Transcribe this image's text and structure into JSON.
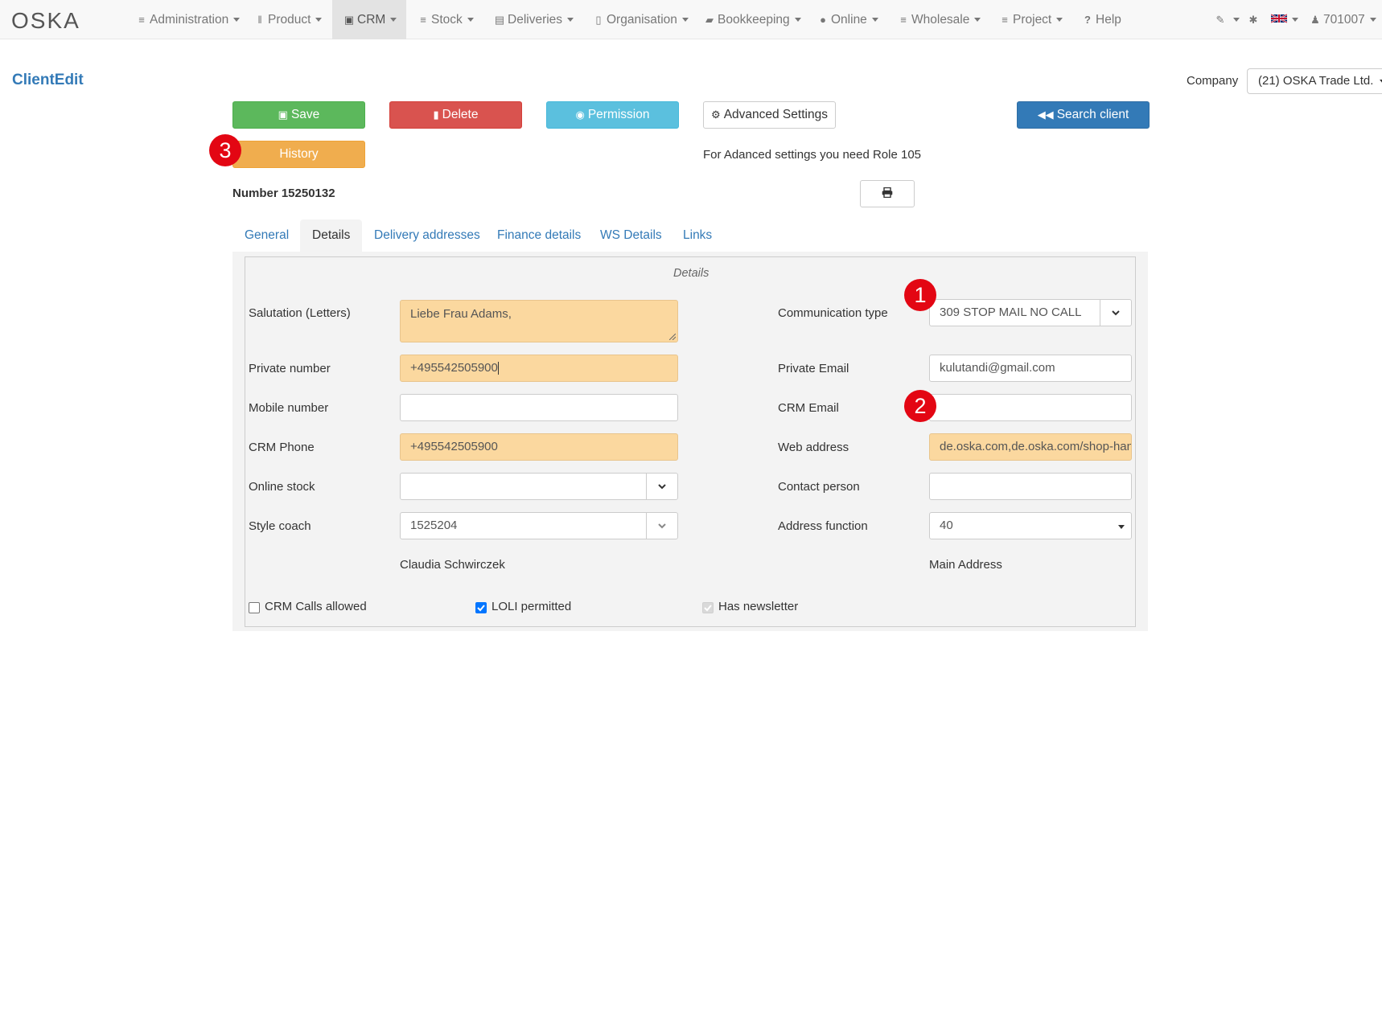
{
  "navbar": {
    "logo_text": "OSKA",
    "items": [
      {
        "label": "Administration",
        "icon": "list-icon"
      },
      {
        "label": "Product",
        "icon": "barcode-icon"
      },
      {
        "label": "CRM",
        "icon": "contact-card-icon"
      },
      {
        "label": "Stock",
        "icon": "list-icon"
      },
      {
        "label": "Deliveries",
        "icon": "archive-box-icon"
      },
      {
        "label": "Organisation",
        "icon": "building-icon"
      },
      {
        "label": "Bookkeeping",
        "icon": "book-icon"
      },
      {
        "label": "Online",
        "icon": "globe-icon"
      },
      {
        "label": "Wholesale",
        "icon": "list-icon"
      },
      {
        "label": "Project",
        "icon": "list-icon"
      },
      {
        "label": "Help",
        "icon": "question-icon"
      }
    ],
    "active_item": "CRM",
    "user_id": "701007",
    "language": "en-GB"
  },
  "page": {
    "title": "ClientEdit",
    "company_label": "Company",
    "company_value": "(21) OSKA Trade Ltd."
  },
  "buttons": {
    "save": "Save",
    "delete": "Delete",
    "permission": "Permission",
    "advanced_settings": "Advanced Settings",
    "search_client": "Search client",
    "history": "History"
  },
  "advanced_note": "For Adanced settings you need Role 105",
  "number_label": "Number 15250132",
  "tabs": [
    {
      "label": "General",
      "active": false
    },
    {
      "label": "Details",
      "active": true
    },
    {
      "label": "Delivery addresses",
      "active": false
    },
    {
      "label": "Finance details",
      "active": false
    },
    {
      "label": "WS Details",
      "active": false
    },
    {
      "label": "Links",
      "active": false
    }
  ],
  "details": {
    "legend": "Details",
    "salutation": {
      "label": "Salutation (Letters)",
      "value": "Liebe Frau Adams,"
    },
    "private_number": {
      "label": "Private number",
      "value": "+495542505900"
    },
    "mobile_number": {
      "label": "Mobile number",
      "value": ""
    },
    "crm_phone": {
      "label": "CRM Phone",
      "value": "+495542505900"
    },
    "online_stock": {
      "label": "Online stock",
      "value": ""
    },
    "style_coach": {
      "label": "Style coach",
      "value": "1525204",
      "name": "Claudia Schwirczek"
    },
    "communication_type": {
      "label": "Communication type",
      "value": "309 STOP MAIL NO CALL"
    },
    "private_email": {
      "label": "Private Email",
      "value": "kulutandi@gmail.com"
    },
    "crm_email": {
      "label": "CRM Email",
      "value": ""
    },
    "web_address": {
      "label": "Web address",
      "value": "de.oska.com,de.oska.com/shop-han"
    },
    "contact_person": {
      "label": "Contact person",
      "value": ""
    },
    "address_function": {
      "label": "Address function",
      "value": "40",
      "description": "Main Address"
    },
    "checkboxes": [
      {
        "label": "CRM Calls allowed",
        "checked": false,
        "disabled": false
      },
      {
        "label": "LOLI permitted",
        "checked": true,
        "disabled": false
      },
      {
        "label": "Has newsletter",
        "checked": true,
        "disabled": true
      }
    ]
  },
  "annotations": [
    "1",
    "2",
    "3"
  ],
  "colors": {
    "save": "#5cb85c",
    "delete": "#d9534f",
    "permission": "#5bc0de",
    "search": "#337ab7",
    "history": "#f0ad4e",
    "highlight_field": "#fbd89f",
    "badge": "#e30613"
  }
}
